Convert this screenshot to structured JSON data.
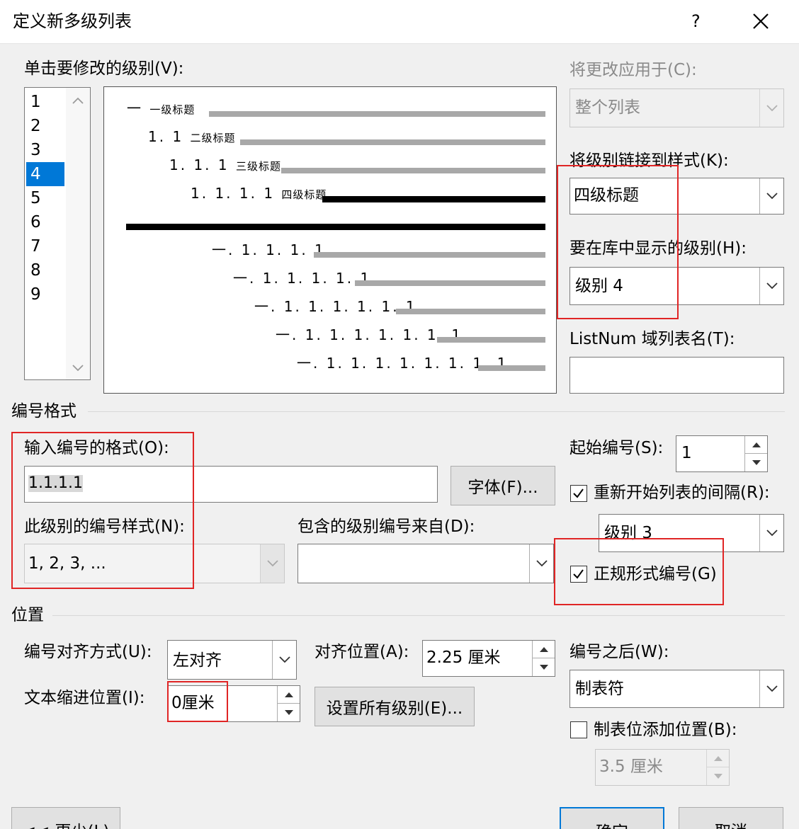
{
  "dialog": {
    "title": "定义新多级列表",
    "help": "?",
    "close": "✕"
  },
  "levels": {
    "label": "单击要修改的级别(V):",
    "items": [
      "1",
      "2",
      "3",
      "4",
      "5",
      "6",
      "7",
      "8",
      "9"
    ],
    "selected_index": 3
  },
  "preview": {
    "line1_num": "一",
    "line1_text": "一级标题",
    "line2_num": "1. 1",
    "line2_text": "二级标题",
    "line3_num": "1. 1. 1",
    "line3_text": "三级标题",
    "line4_num": "1. 1. 1. 1",
    "line4_text": "四级标题",
    "line6": "一. 1. 1. 1. 1",
    "line7": "一. 1. 1. 1. 1. 1",
    "line8": "一. 1. 1. 1. 1. 1. 1",
    "line9": "一. 1. 1. 1. 1. 1. 1. 1",
    "line10": "一. 1. 1. 1. 1. 1. 1. 1. 1"
  },
  "apply_to": {
    "label": "将更改应用于(C):",
    "value": "整个列表"
  },
  "link_style": {
    "label": "将级别链接到样式(K):",
    "value": "四级标题"
  },
  "gallery_level": {
    "label": "要在库中显示的级别(H):",
    "value": "级别 4"
  },
  "listnum": {
    "label": "ListNum 域列表名(T):",
    "value": ""
  },
  "number_format": {
    "section": "编号格式",
    "enter_label": "输入编号的格式(O):",
    "enter_value": "1.1.1.1",
    "font_button": "字体(F)...",
    "style_label": "此级别的编号样式(N):",
    "style_value": "1, 2, 3, ...",
    "include_label": "包含的级别编号来自(D):",
    "include_value": "",
    "start_label": "起始编号(S):",
    "start_value": "1",
    "restart_label": "重新开始列表的间隔(R):",
    "restart_checked": true,
    "restart_value": "级别 3",
    "legal_label": "正规形式编号(G)",
    "legal_checked": true
  },
  "position": {
    "section": "位置",
    "align_label": "编号对齐方式(U):",
    "align_value": "左对齐",
    "at_label": "对齐位置(A):",
    "at_value": "2.25 厘米",
    "indent_label": "文本缩进位置(I):",
    "indent_value": "0厘米",
    "set_all_button": "设置所有级别(E)...",
    "follow_label": "编号之后(W):",
    "follow_value": "制表符",
    "tab_label": "制表位添加位置(B):",
    "tab_checked": false,
    "tab_value": "3.5 厘米"
  },
  "footer": {
    "less": "<< 更少(L)",
    "ok": "确定",
    "cancel": "取消"
  },
  "colors": {
    "selection": "#0078d7",
    "highlight_box": "#e02525"
  }
}
